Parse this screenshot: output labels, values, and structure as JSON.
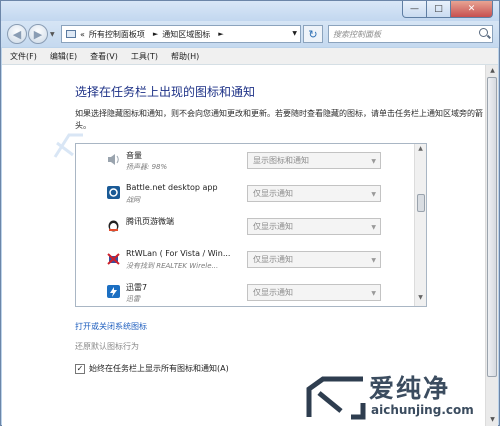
{
  "address": {
    "prefix": "«",
    "crumbs": [
      "所有控制面板项",
      "通知区域图标"
    ],
    "separator": "►"
  },
  "search": {
    "placeholder": "搜索控制面板"
  },
  "menu": [
    "文件(F)",
    "编辑(E)",
    "查看(V)",
    "工具(T)",
    "帮助(H)"
  ],
  "heading": "选择在任务栏上出现的图标和通知",
  "description": "如果选择隐藏图标和通知，则不会向您通知更改和更新。若要随时查看隐藏的图标，请单击任务栏上通知区域旁的箭头。",
  "rows": [
    {
      "name": "音量",
      "sub": "扬声器: 98%",
      "value": "显示图标和通知",
      "icon": "speaker-icon"
    },
    {
      "name": "Battle.net desktop app",
      "sub": "战网",
      "value": "仅显示通知",
      "icon": "battlenet-icon"
    },
    {
      "name": "腾讯页游微端",
      "sub": "",
      "value": "仅显示通知",
      "icon": "tencent-icon"
    },
    {
      "name": "RtWLan ( For Vista / Win...",
      "sub": "没有找到 REALTEK Wirele...",
      "value": "仅显示通知",
      "icon": "wlan-icon"
    },
    {
      "name": "迅雷7",
      "sub": "迅雷",
      "value": "仅显示通知",
      "icon": "thunder-icon"
    }
  ],
  "links": {
    "system_icons": "打开或关闭系统图标",
    "restore_default": "还原默认图标行为"
  },
  "checkbox": {
    "label": "始终在任务栏上显示所有图标和通知(A)",
    "checked": true
  },
  "watermark": {
    "title": "爱纯净",
    "url": "aichunjing.com"
  }
}
